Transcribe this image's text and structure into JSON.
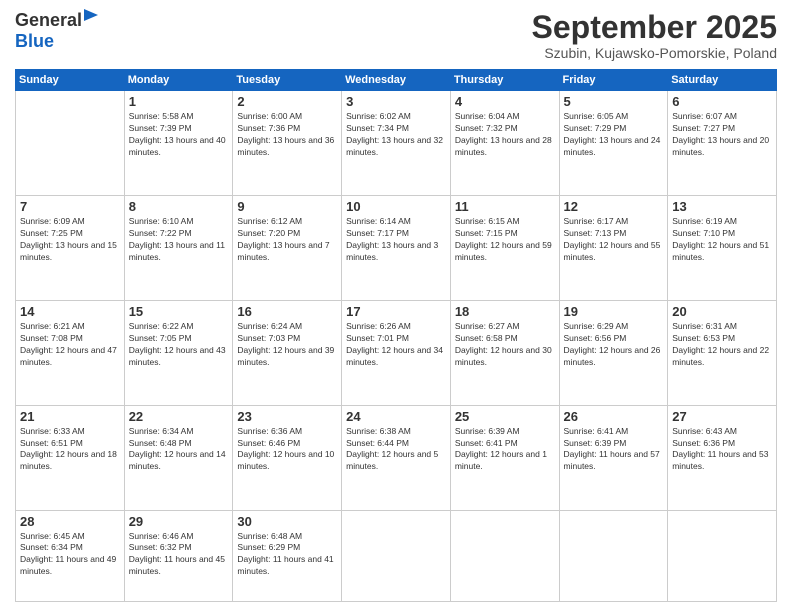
{
  "header": {
    "logo_line1": "General",
    "logo_line2": "Blue",
    "month_title": "September 2025",
    "location": "Szubin, Kujawsko-Pomorskie, Poland"
  },
  "weekdays": [
    "Sunday",
    "Monday",
    "Tuesday",
    "Wednesday",
    "Thursday",
    "Friday",
    "Saturday"
  ],
  "weeks": [
    [
      {
        "day": null
      },
      {
        "day": "1",
        "sunrise": "5:58 AM",
        "sunset": "7:39 PM",
        "daylight": "13 hours and 40 minutes."
      },
      {
        "day": "2",
        "sunrise": "6:00 AM",
        "sunset": "7:36 PM",
        "daylight": "13 hours and 36 minutes."
      },
      {
        "day": "3",
        "sunrise": "6:02 AM",
        "sunset": "7:34 PM",
        "daylight": "13 hours and 32 minutes."
      },
      {
        "day": "4",
        "sunrise": "6:04 AM",
        "sunset": "7:32 PM",
        "daylight": "13 hours and 28 minutes."
      },
      {
        "day": "5",
        "sunrise": "6:05 AM",
        "sunset": "7:29 PM",
        "daylight": "13 hours and 24 minutes."
      },
      {
        "day": "6",
        "sunrise": "6:07 AM",
        "sunset": "7:27 PM",
        "daylight": "13 hours and 20 minutes."
      }
    ],
    [
      {
        "day": "7",
        "sunrise": "6:09 AM",
        "sunset": "7:25 PM",
        "daylight": "13 hours and 15 minutes."
      },
      {
        "day": "8",
        "sunrise": "6:10 AM",
        "sunset": "7:22 PM",
        "daylight": "13 hours and 11 minutes."
      },
      {
        "day": "9",
        "sunrise": "6:12 AM",
        "sunset": "7:20 PM",
        "daylight": "13 hours and 7 minutes."
      },
      {
        "day": "10",
        "sunrise": "6:14 AM",
        "sunset": "7:17 PM",
        "daylight": "13 hours and 3 minutes."
      },
      {
        "day": "11",
        "sunrise": "6:15 AM",
        "sunset": "7:15 PM",
        "daylight": "12 hours and 59 minutes."
      },
      {
        "day": "12",
        "sunrise": "6:17 AM",
        "sunset": "7:13 PM",
        "daylight": "12 hours and 55 minutes."
      },
      {
        "day": "13",
        "sunrise": "6:19 AM",
        "sunset": "7:10 PM",
        "daylight": "12 hours and 51 minutes."
      }
    ],
    [
      {
        "day": "14",
        "sunrise": "6:21 AM",
        "sunset": "7:08 PM",
        "daylight": "12 hours and 47 minutes."
      },
      {
        "day": "15",
        "sunrise": "6:22 AM",
        "sunset": "7:05 PM",
        "daylight": "12 hours and 43 minutes."
      },
      {
        "day": "16",
        "sunrise": "6:24 AM",
        "sunset": "7:03 PM",
        "daylight": "12 hours and 39 minutes."
      },
      {
        "day": "17",
        "sunrise": "6:26 AM",
        "sunset": "7:01 PM",
        "daylight": "12 hours and 34 minutes."
      },
      {
        "day": "18",
        "sunrise": "6:27 AM",
        "sunset": "6:58 PM",
        "daylight": "12 hours and 30 minutes."
      },
      {
        "day": "19",
        "sunrise": "6:29 AM",
        "sunset": "6:56 PM",
        "daylight": "12 hours and 26 minutes."
      },
      {
        "day": "20",
        "sunrise": "6:31 AM",
        "sunset": "6:53 PM",
        "daylight": "12 hours and 22 minutes."
      }
    ],
    [
      {
        "day": "21",
        "sunrise": "6:33 AM",
        "sunset": "6:51 PM",
        "daylight": "12 hours and 18 minutes."
      },
      {
        "day": "22",
        "sunrise": "6:34 AM",
        "sunset": "6:48 PM",
        "daylight": "12 hours and 14 minutes."
      },
      {
        "day": "23",
        "sunrise": "6:36 AM",
        "sunset": "6:46 PM",
        "daylight": "12 hours and 10 minutes."
      },
      {
        "day": "24",
        "sunrise": "6:38 AM",
        "sunset": "6:44 PM",
        "daylight": "12 hours and 5 minutes."
      },
      {
        "day": "25",
        "sunrise": "6:39 AM",
        "sunset": "6:41 PM",
        "daylight": "12 hours and 1 minute."
      },
      {
        "day": "26",
        "sunrise": "6:41 AM",
        "sunset": "6:39 PM",
        "daylight": "11 hours and 57 minutes."
      },
      {
        "day": "27",
        "sunrise": "6:43 AM",
        "sunset": "6:36 PM",
        "daylight": "11 hours and 53 minutes."
      }
    ],
    [
      {
        "day": "28",
        "sunrise": "6:45 AM",
        "sunset": "6:34 PM",
        "daylight": "11 hours and 49 minutes."
      },
      {
        "day": "29",
        "sunrise": "6:46 AM",
        "sunset": "6:32 PM",
        "daylight": "11 hours and 45 minutes."
      },
      {
        "day": "30",
        "sunrise": "6:48 AM",
        "sunset": "6:29 PM",
        "daylight": "11 hours and 41 minutes."
      },
      {
        "day": null
      },
      {
        "day": null
      },
      {
        "day": null
      },
      {
        "day": null
      }
    ]
  ]
}
